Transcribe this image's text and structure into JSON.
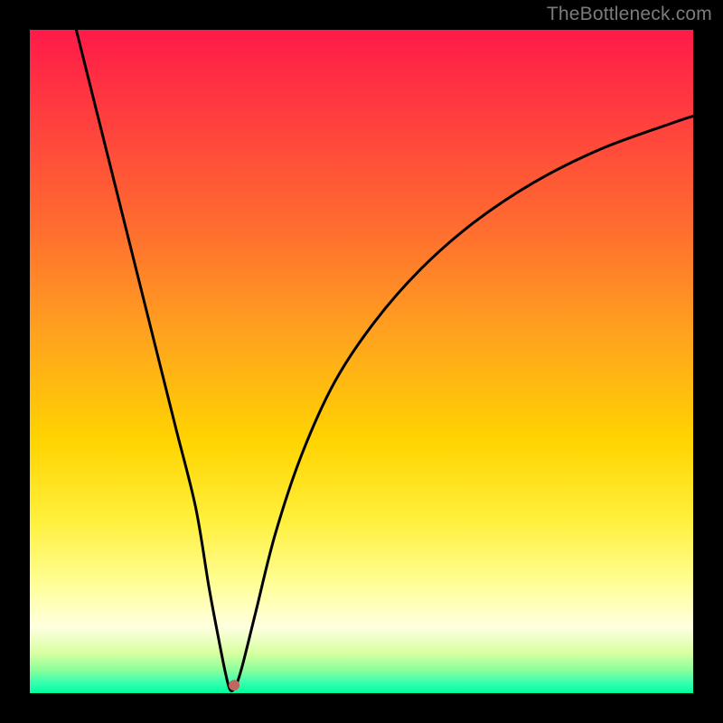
{
  "watermark": "TheBottleneck.com",
  "chart_data": {
    "type": "line",
    "title": "",
    "xlabel": "",
    "ylabel": "",
    "xlim": [
      0,
      100
    ],
    "ylim": [
      0,
      100
    ],
    "background_gradient": {
      "stops": [
        {
          "pos": 0.0,
          "color": "#ff1a49"
        },
        {
          "pos": 0.12,
          "color": "#ff3b3f"
        },
        {
          "pos": 0.3,
          "color": "#ff6d2f"
        },
        {
          "pos": 0.46,
          "color": "#ffa31e"
        },
        {
          "pos": 0.62,
          "color": "#ffd400"
        },
        {
          "pos": 0.74,
          "color": "#fff03c"
        },
        {
          "pos": 0.84,
          "color": "#ffff9c"
        },
        {
          "pos": 0.9,
          "color": "#ffffe0"
        },
        {
          "pos": 0.94,
          "color": "#d7ffa0"
        },
        {
          "pos": 0.965,
          "color": "#8bff9c"
        },
        {
          "pos": 0.985,
          "color": "#33ffb0"
        },
        {
          "pos": 1.0,
          "color": "#00ff9e"
        }
      ]
    },
    "series": [
      {
        "name": "bottleneck-curve",
        "x": [
          7,
          10,
          13,
          16,
          19,
          22,
          25,
          27,
          28.5,
          29.5,
          30.2,
          31,
          32,
          34,
          37,
          41,
          46,
          52,
          59,
          67,
          76,
          86,
          97,
          100
        ],
        "y": [
          100,
          88,
          76,
          64,
          52,
          40,
          28,
          16,
          8,
          3,
          0.5,
          1,
          4,
          12,
          24,
          36,
          47,
          56,
          64,
          71,
          77,
          82,
          86,
          87
        ]
      }
    ],
    "marker": {
      "x": 30.8,
      "y": 1.2,
      "color": "#c1675e",
      "radius_px": 6
    }
  }
}
